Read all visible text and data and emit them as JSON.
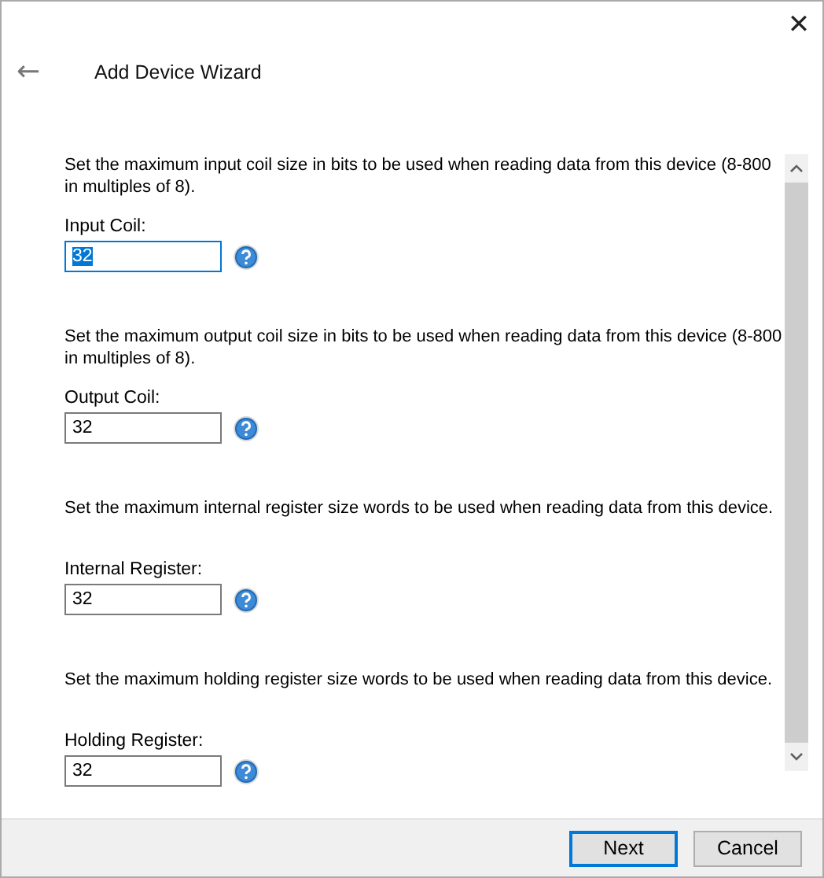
{
  "window": {
    "title": "Add Device Wizard",
    "close": "✕",
    "back": "←"
  },
  "fields": [
    {
      "description": "Set the maximum input coil size in bits to be used when reading data from this device (8-800 in multiples of 8).",
      "label": "Input Coil:",
      "value": "32",
      "focused": true
    },
    {
      "description": "Set the maximum output coil size in bits to be used when reading data from this device (8-800 in multiples of 8).",
      "label": "Output Coil:",
      "value": "32",
      "focused": false
    },
    {
      "description": "Set the maximum internal register size words to be used when reading data from this device.",
      "label": "Internal Register:",
      "value": "32",
      "focused": false
    },
    {
      "description": "Set the maximum holding register size words to be used when reading data from this device.",
      "label": "Holding Register:",
      "value": "32",
      "focused": false
    }
  ],
  "buttons": [
    {
      "label": "Next",
      "default": true
    },
    {
      "label": "Cancel",
      "default": false
    }
  ]
}
